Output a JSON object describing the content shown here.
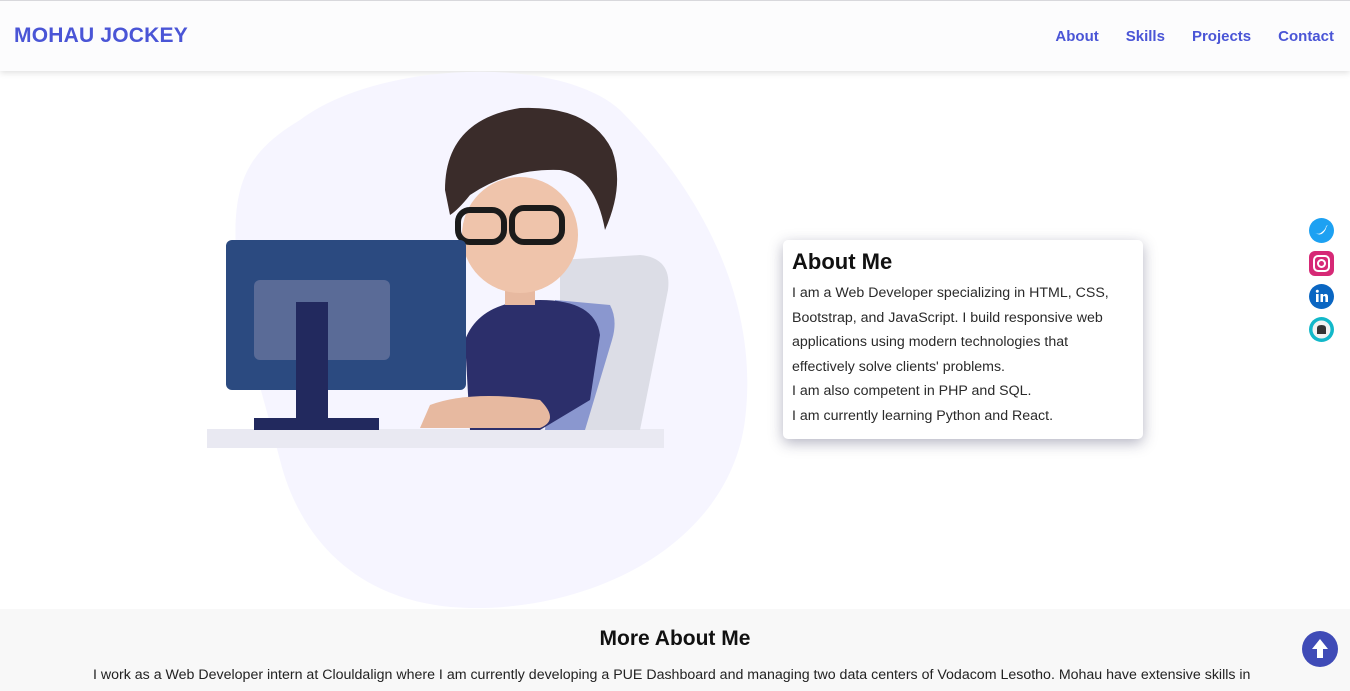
{
  "navbar": {
    "brand": "MOHAU JOCKEY",
    "links": [
      {
        "label": "About"
      },
      {
        "label": "Skills"
      },
      {
        "label": "Projects"
      },
      {
        "label": "Contact"
      }
    ]
  },
  "about": {
    "title": "About Me",
    "lines": [
      "I am a Web Developer specializing in HTML, CSS, Bootstrap, and JavaScript. I build responsive web applications using modern technologies that effectively solve clients' problems.",
      "I am also competent in PHP and SQL.",
      "I am currently learning Python and React."
    ]
  },
  "social": [
    {
      "icon": "twitter-icon"
    },
    {
      "icon": "instagram-icon"
    },
    {
      "icon": "linkedin-icon"
    },
    {
      "icon": "github-icon"
    }
  ],
  "more": {
    "title": "More About Me",
    "text": "I work as a Web Developer intern at Clouldalign where I am currently developing a PUE Dashboard and managing two data centers of Vodacom Lesotho. Mohau have extensive skills in"
  },
  "colors": {
    "accent": "#4a55d6",
    "blob": "#f6f5ff",
    "to_top": "#3f4bb7"
  }
}
